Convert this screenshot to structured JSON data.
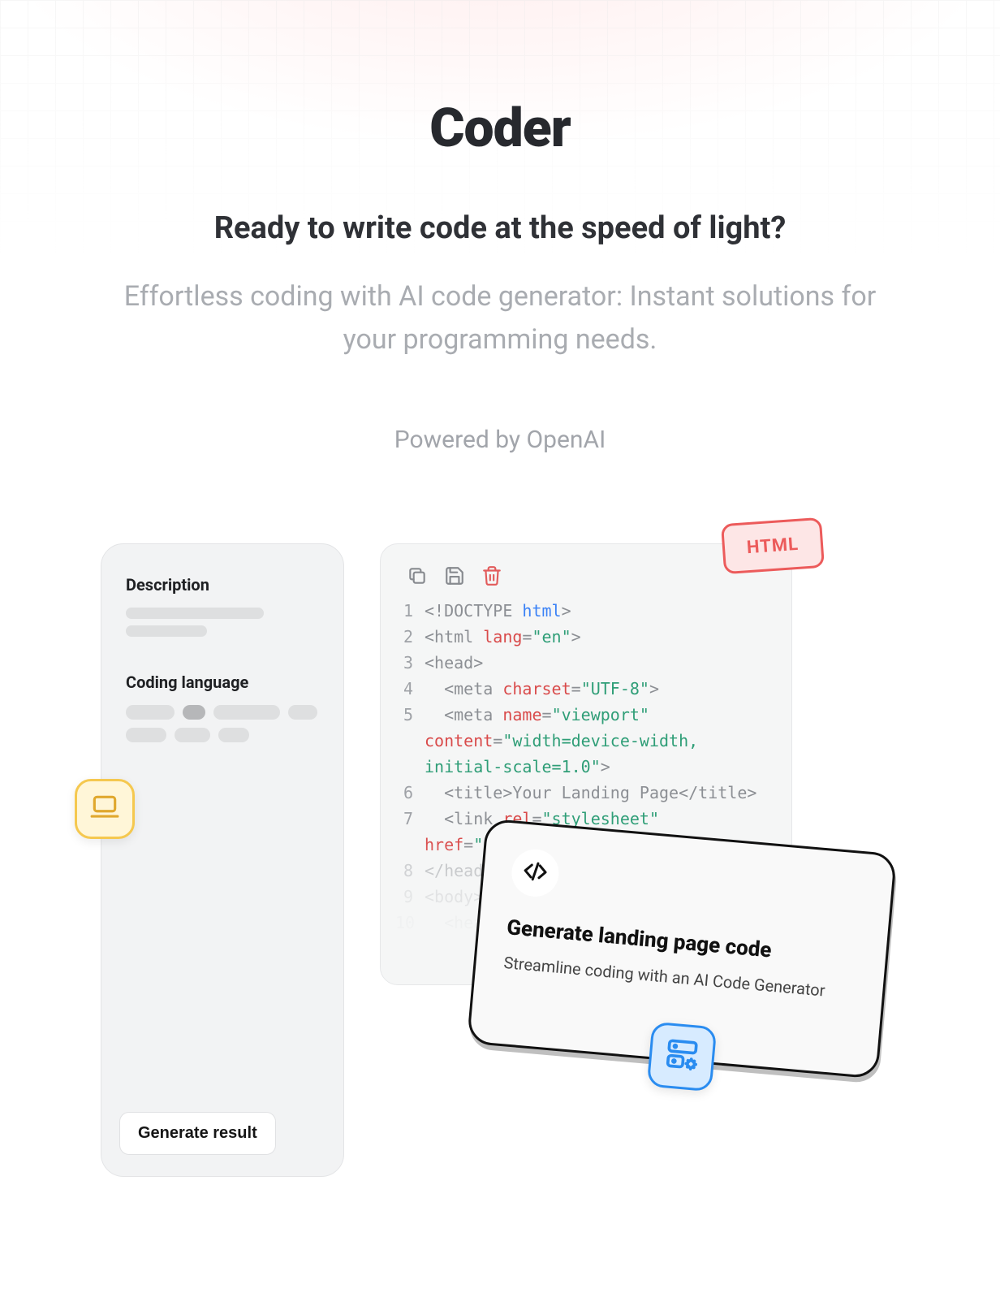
{
  "hero": {
    "title": "Coder",
    "subtitle": "Ready to write code at the speed of light?",
    "description": "Effortless coding with AI code generator: Instant solutions for your programming needs.",
    "powered_by": "Powered by OpenAI"
  },
  "left_panel": {
    "description_heading": "Description",
    "language_heading": "Coding language",
    "generate_button": "Generate result"
  },
  "html_badge": {
    "label": "HTML"
  },
  "code_panel": {
    "lines": [
      {
        "n": "1",
        "html": "<span class='t-gray'>&lt;!DOCTYPE </span><span class='t-keyword'>html</span><span class='t-gray'>&gt;</span>"
      },
      {
        "n": "2",
        "html": "<span class='t-gray'>&lt;html </span><span class='t-attr'>lang</span><span class='t-gray'>=</span><span class='t-str'>\"en\"</span><span class='t-gray'>&gt;</span>"
      },
      {
        "n": "3",
        "html": "<span class='t-gray'>&lt;head&gt;</span>"
      },
      {
        "n": "4",
        "html": "&nbsp;&nbsp;<span class='t-gray'>&lt;meta </span><span class='t-attr'>charset</span><span class='t-gray'>=</span><span class='t-str'>\"UTF-8\"</span><span class='t-gray'>&gt;</span>"
      },
      {
        "n": "5",
        "html": "&nbsp;&nbsp;<span class='t-gray'>&lt;meta </span><span class='t-attr'>name</span><span class='t-gray'>=</span><span class='t-str'>\"viewport\"</span> <span class='t-attr'>content</span><span class='t-gray'>=</span><span class='t-str'>\"width=device-width, initial-scale=1.0\"</span><span class='t-gray'>&gt;</span>"
      },
      {
        "n": "6",
        "html": "&nbsp;&nbsp;<span class='t-gray'>&lt;title&gt;Your Landing Page&lt;/title&gt;</span>"
      },
      {
        "n": "7",
        "html": "&nbsp;&nbsp;<span class='t-gray'>&lt;link </span><span class='t-attr'>rel</span><span class='t-gray'>=</span><span class='t-str'>\"stylesheet\"</span> <span class='t-attr'>href</span><span class='t-gray'>=</span><span class='t-str'>\"styles.css\"</span><span class='t-gray'>&gt;</span>"
      },
      {
        "n": "8",
        "html": "<span class='t-gray'>&lt;/head&gt;</span>",
        "cls": "code-fade1"
      },
      {
        "n": "9",
        "html": "<span class='t-gray'>&lt;body&gt;</span>",
        "cls": "code-fade2"
      },
      {
        "n": "10",
        "html": "&nbsp;&nbsp;<span class='t-gray'>&lt;head...</span>",
        "cls": "code-fade3"
      }
    ]
  },
  "promo": {
    "title": "Generate landing page code",
    "description": "Streamline coding with an AI Code Generator"
  },
  "icons": {
    "laptop": "laptop-icon",
    "copy": "copy-icon",
    "save": "save-icon",
    "trash": "trash-icon",
    "code": "code-icon",
    "server_gear": "server-gear-icon"
  }
}
